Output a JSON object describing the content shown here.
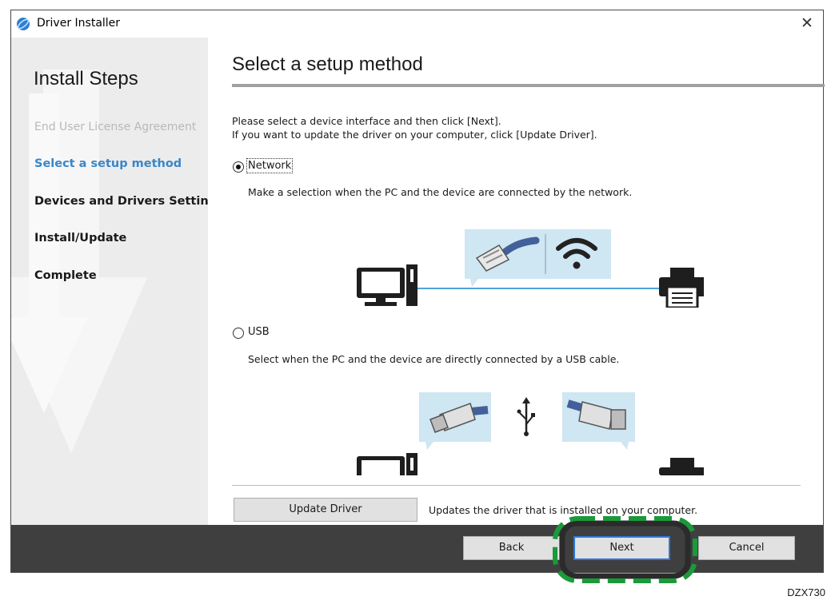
{
  "window": {
    "title": "Driver Installer",
    "close_glyph": "✕"
  },
  "sidebar": {
    "title": "Install Steps",
    "steps": [
      {
        "label": "End User License Agreement",
        "state": "done"
      },
      {
        "label": "Select a setup method",
        "state": "current"
      },
      {
        "label": "Devices and Drivers Settings",
        "state": "pending"
      },
      {
        "label": "Install/Update",
        "state": "pending"
      },
      {
        "label": "Complete",
        "state": "pending"
      }
    ]
  },
  "main": {
    "title": "Select a setup method",
    "instructions": [
      "Please select a device interface and then click [Next].",
      "If you want to update the driver on your computer, click [Update Driver]."
    ],
    "options": [
      {
        "label": "Network",
        "selected": true,
        "description": "Make a selection when the PC and the device are connected by the network."
      },
      {
        "label": "USB",
        "selected": false,
        "description": "Select when the PC and the device are directly connected by a USB cable."
      }
    ],
    "update_button": "Update Driver",
    "update_description": "Updates the driver that is installed on your computer."
  },
  "footer": {
    "back": "Back",
    "next": "Next",
    "cancel": "Cancel"
  },
  "figure_code": "DZX730",
  "colors": {
    "accent_blue": "#3a86c8",
    "highlight_green": "#1a9a3a",
    "footer_bg": "#3f3f3f",
    "illustration_panel": "#cfe6f3"
  },
  "icons": {
    "app": "driver-installer-icon",
    "close": "close-icon",
    "wifi": "wifi-icon",
    "usb": "usb-symbol-icon",
    "computer": "computer-icon",
    "printer": "printer-icon"
  }
}
